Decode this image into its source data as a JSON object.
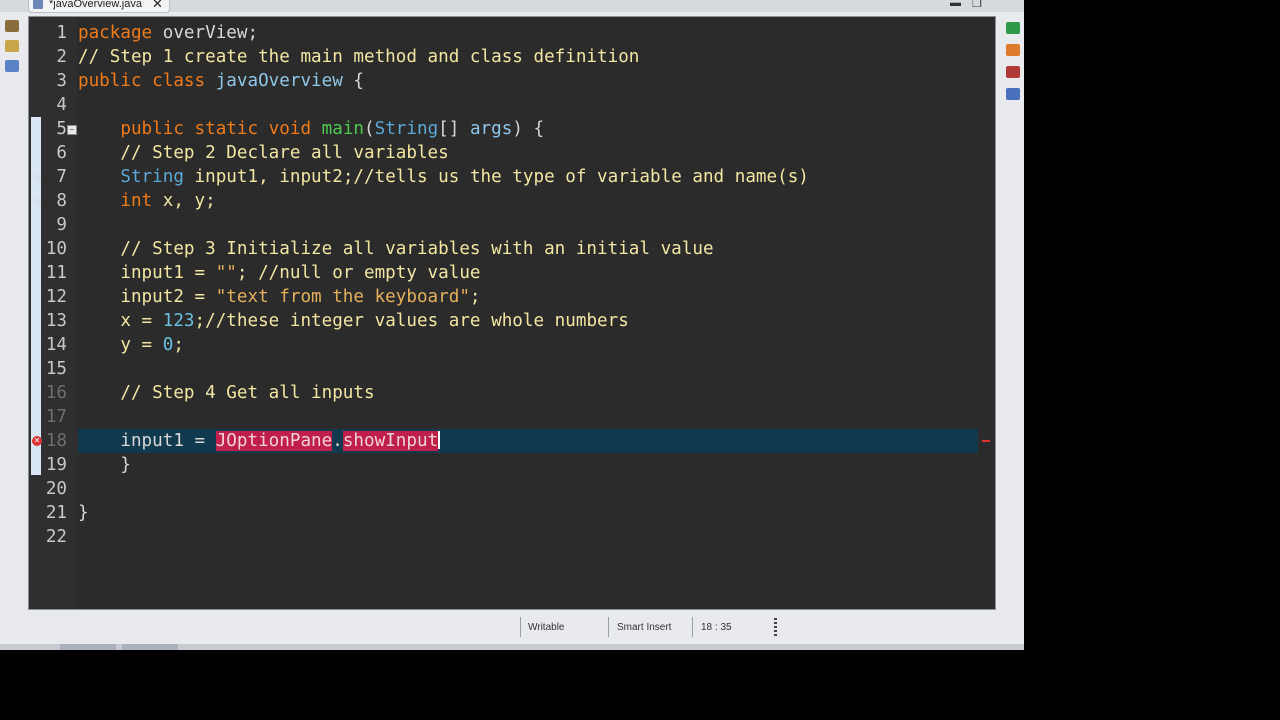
{
  "tab": {
    "title": "*javaOverview.java"
  },
  "editor": {
    "lines": [
      {
        "n": "1"
      },
      {
        "n": "2"
      },
      {
        "n": "3"
      },
      {
        "n": "4"
      },
      {
        "n": "5"
      },
      {
        "n": "6"
      },
      {
        "n": "7"
      },
      {
        "n": "8"
      },
      {
        "n": "9"
      },
      {
        "n": "10"
      },
      {
        "n": "11"
      },
      {
        "n": "12"
      },
      {
        "n": "13"
      },
      {
        "n": "14"
      },
      {
        "n": "15"
      },
      {
        "n": "16"
      },
      {
        "n": "17"
      },
      {
        "n": "18"
      },
      {
        "n": "19"
      },
      {
        "n": "20"
      },
      {
        "n": "21"
      },
      {
        "n": "22"
      }
    ],
    "code": {
      "l1_kw": "package",
      "l1_rest": " overView;",
      "l2": "// Step 1 create the main method and class definition",
      "l3_kw": "public class",
      "l3_name": " javaOverview",
      "l3_rest": " {",
      "l5_kw": "    public static void",
      "l5_meth": " main",
      "l5_p": "(",
      "l5_type": "String",
      "l5_br": "[] ",
      "l5_arg": "args",
      "l5_end": ") {",
      "l6": "    // Step 2 Declare all variables",
      "l7_type": "    String",
      "l7_vars": " input1, input2;",
      "l7_cmt": "//tells us the type of variable and name(s)",
      "l8_kw": "    int",
      "l8_rest": " x, y;",
      "l10": "    // Step 3 Initialize all variables with an initial value",
      "l11_a": "    input1 = ",
      "l11_str": "\"\"",
      "l11_b": "; ",
      "l11_cmt": "//null or empty value",
      "l12_a": "    input2 = ",
      "l12_str": "\"text from the keyboard\"",
      "l12_b": ";",
      "l13_a": "    x = ",
      "l13_num": "123",
      "l13_b": ";",
      "l13_cmt": "//these integer values are whole numbers",
      "l14_a": "    y = ",
      "l14_num": "0",
      "l14_b": ";",
      "l16": "    // Step 4 Get all inputs",
      "l18_a": "    input1 = ",
      "l18_err1": "JOptionPane",
      "l18_dot": ".",
      "l18_err2": "showInput",
      "l19": "    }",
      "l21": "}"
    }
  },
  "status": {
    "writable": "Writable",
    "insert_mode": "Smart Insert",
    "position": "18 : 35"
  },
  "colors": {
    "editor_bg": "#2b2b2b",
    "keyword": "#ee7a1a",
    "comment": "#f2e6a2",
    "string": "#e5b05c",
    "error": "#c01f4a",
    "current_line": "#123a4e"
  }
}
